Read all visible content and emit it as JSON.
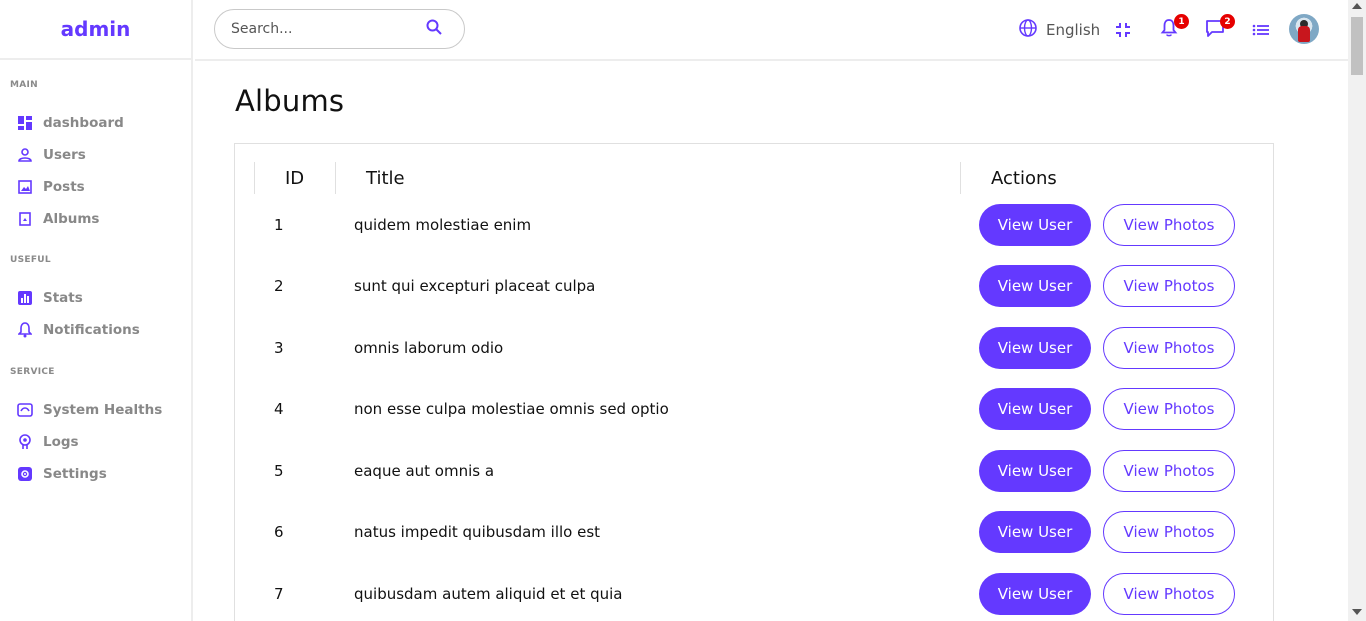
{
  "sidebar": {
    "logo": "admin",
    "sections": [
      {
        "title": "MAIN",
        "items": [
          {
            "label": "dashboard",
            "icon": "dashboard-icon"
          },
          {
            "label": "Users",
            "icon": "user-icon"
          },
          {
            "label": "Posts",
            "icon": "image-icon"
          },
          {
            "label": "Albums",
            "icon": "album-icon"
          }
        ]
      },
      {
        "title": "USEFUL",
        "items": [
          {
            "label": "Stats",
            "icon": "chart-icon"
          },
          {
            "label": "Notifications",
            "icon": "bell-icon"
          }
        ]
      },
      {
        "title": "SERVICE",
        "items": [
          {
            "label": "System Healths",
            "icon": "system-health-icon"
          },
          {
            "label": "Logs",
            "icon": "brain-icon"
          },
          {
            "label": "Settings",
            "icon": "gear-icon"
          }
        ]
      }
    ]
  },
  "topbar": {
    "search_placeholder": "Search...",
    "language": "English",
    "notifications_count": "1",
    "messages_count": "2"
  },
  "page": {
    "title": "Albums",
    "columns": {
      "id": "ID",
      "title": "Title",
      "actions": "Actions"
    },
    "rows": [
      {
        "id": "1",
        "title": "quidem molestiae enim"
      },
      {
        "id": "2",
        "title": "sunt qui excepturi placeat culpa"
      },
      {
        "id": "3",
        "title": "omnis laborum odio"
      },
      {
        "id": "4",
        "title": "non esse culpa molestiae omnis sed optio"
      },
      {
        "id": "5",
        "title": "eaque aut omnis a"
      },
      {
        "id": "6",
        "title": "natus impedit quibusdam illo est"
      },
      {
        "id": "7",
        "title": "quibusdam autem aliquid et et quia"
      }
    ],
    "view_user_label": "View User",
    "view_photos_label": "View Photos"
  },
  "colors": {
    "accent": "#6439ff",
    "badge": "#e60000",
    "muted_text": "#888888"
  }
}
